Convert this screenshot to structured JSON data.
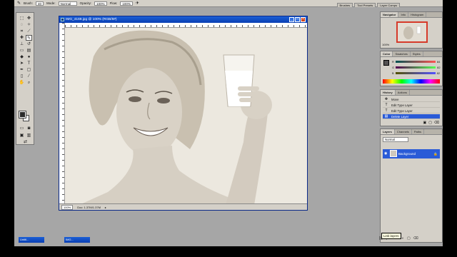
{
  "options_bar": {
    "brush_label": "Brush:",
    "brush_size": "40",
    "mode_label": "Mode:",
    "mode_value": "Normal",
    "opacity_label": "Opacity:",
    "opacity_value": "100%",
    "flow_label": "Flow:",
    "flow_value": "100%"
  },
  "palette_well": {
    "tabs": [
      "Brushes",
      "Tool Presets",
      "Layer Comps"
    ]
  },
  "document": {
    "title": "IMG_4169.jpg @ 100% (RGB/8#)",
    "zoom": "100%",
    "doc_size": "Doc: 1.37M/1.37M",
    "min_label": "_",
    "max_label": "□",
    "close_label": "×"
  },
  "navigator": {
    "tabs": [
      "Navigator",
      "Info",
      "Histogram"
    ],
    "zoom": "100%"
  },
  "color": {
    "tabs": [
      "Color",
      "Swatches",
      "Styles"
    ],
    "channels": [
      {
        "label": "R",
        "value": "84"
      },
      {
        "label": "G",
        "value": "82"
      },
      {
        "label": "B",
        "value": "82"
      }
    ]
  },
  "history": {
    "tabs": [
      "History",
      "Actions"
    ],
    "items": [
      "Move",
      "Edit Type Layer",
      "Edit Type Layer",
      "Delete Layer"
    ],
    "selected_index": 3
  },
  "layers": {
    "tabs": [
      "Layers",
      "Channels",
      "Paths"
    ],
    "blend_mode": "Normal",
    "layer_name": "Background"
  },
  "tooltip": "Link layers",
  "minimized_windows": [
    {
      "title": "Untitl..."
    },
    {
      "title": "IMG..."
    }
  ]
}
